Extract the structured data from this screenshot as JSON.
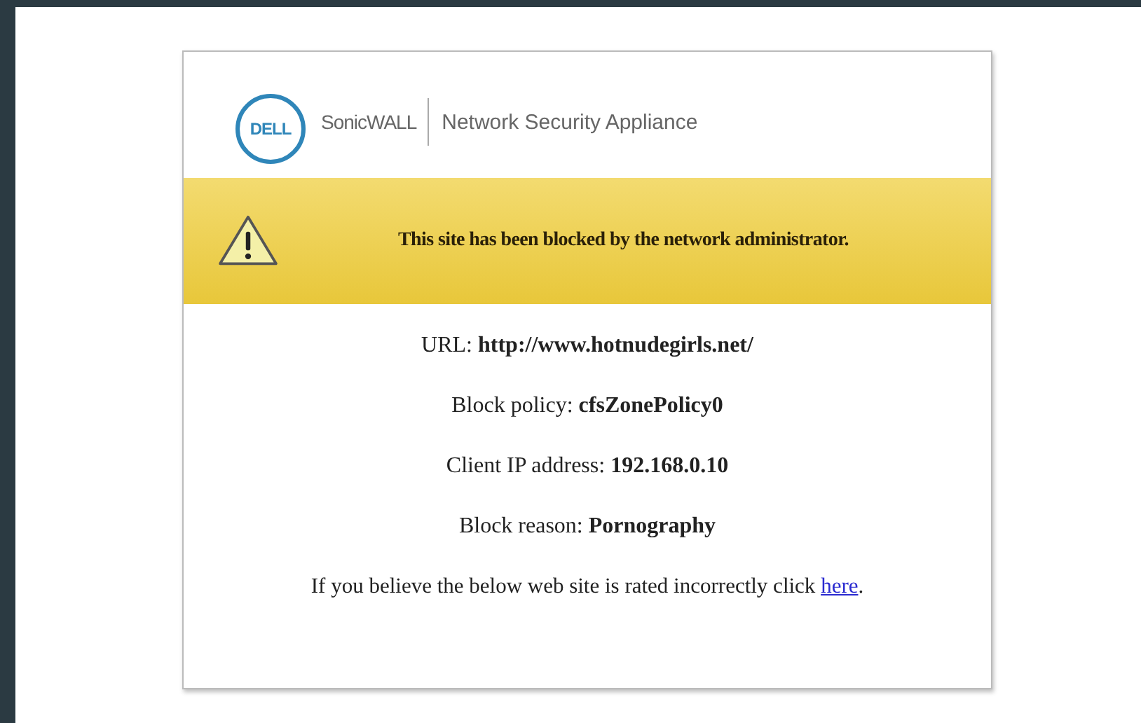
{
  "header": {
    "logo_text": "DELL",
    "brand": "SonicWALL",
    "product": "Network Security Appliance"
  },
  "banner": {
    "message": "This site has been blocked by the network administrator."
  },
  "details": [
    "URL: **http://www.hotnudegirls.net/**",
    "Block policy: **cfsZonePolicy0**",
    "Client IP address: **192.168.0.10**",
    "Block reason: **Pornography**"
  ],
  "notice": {
    "text": "If you believe the below web site is rated incorrectly click ",
    "link": "here",
    "suffix": "."
  }
}
